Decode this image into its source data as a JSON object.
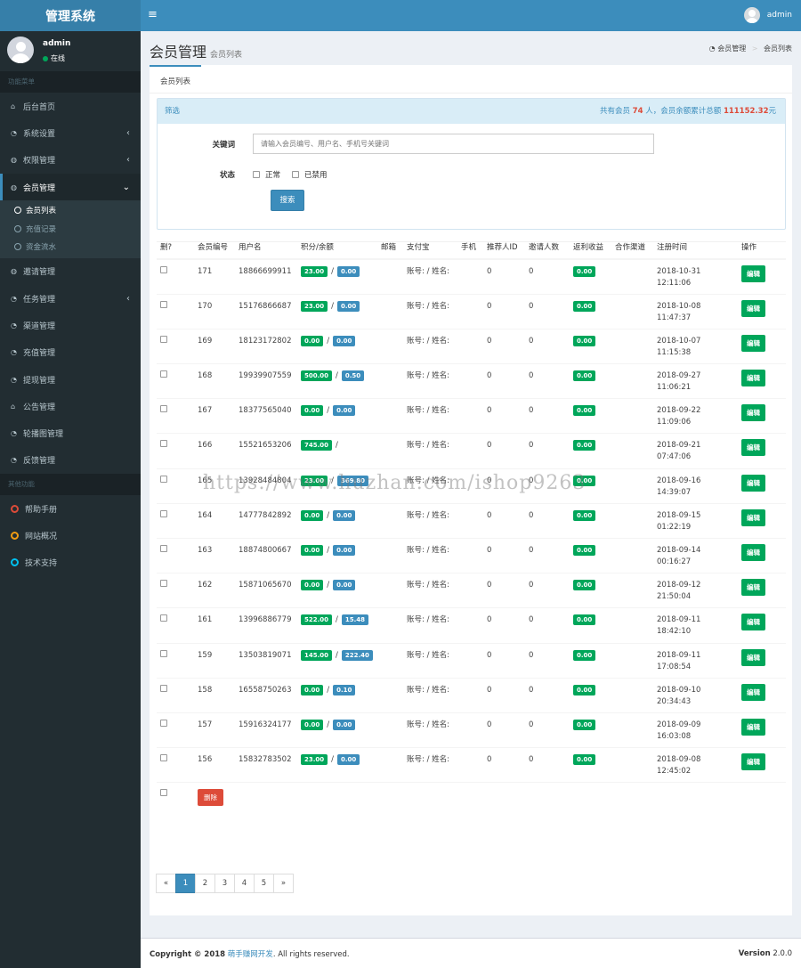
{
  "header": {
    "logo": "管理系统",
    "menu_icon": "≡",
    "username": "admin"
  },
  "sidebar": {
    "username": "admin",
    "status": "在线",
    "section1": "功能菜单",
    "items": [
      {
        "label": "后台首页",
        "icon": "home-icon",
        "glyph": "⌂",
        "chevron": ""
      },
      {
        "label": "系统设置",
        "icon": "dashboard-icon",
        "glyph": "◔",
        "chevron": "‹"
      },
      {
        "label": "权限管理",
        "icon": "users-icon",
        "glyph": "◍",
        "chevron": "‹"
      },
      {
        "label": "会员管理",
        "icon": "user-icon",
        "glyph": "◍",
        "chevron": "⌄"
      }
    ],
    "subitems": [
      "会员列表",
      "充值记录",
      "资金流水"
    ],
    "items2": [
      {
        "label": "邀请管理",
        "icon": "users-icon",
        "glyph": "◍",
        "chevron": ""
      },
      {
        "label": "任务管理",
        "icon": "tasks-icon",
        "glyph": "◔",
        "chevron": "‹"
      },
      {
        "label": "渠道管理",
        "icon": "dashboard-icon",
        "glyph": "◔",
        "chevron": ""
      },
      {
        "label": "充值管理",
        "icon": "dashboard-icon",
        "glyph": "◔",
        "chevron": ""
      },
      {
        "label": "提现管理",
        "icon": "dashboard-icon",
        "glyph": "◔",
        "chevron": ""
      },
      {
        "label": "公告管理",
        "icon": "home-icon",
        "glyph": "⌂",
        "chevron": ""
      },
      {
        "label": "轮播图管理",
        "icon": "dashboard-icon",
        "glyph": "◔",
        "chevron": ""
      },
      {
        "label": "反馈管理",
        "icon": "dashboard-icon",
        "glyph": "◔",
        "chevron": ""
      }
    ],
    "section2": "其他功能",
    "others": [
      {
        "label": "帮助手册",
        "color": "#dd4b39"
      },
      {
        "label": "网站概况",
        "color": "#f39c12"
      },
      {
        "label": "技术支持",
        "color": "#00c0ef"
      }
    ]
  },
  "page": {
    "title": "会员管理",
    "subtitle": "会员列表",
    "breadcrumb": [
      "会员管理",
      "会员列表"
    ],
    "tab": "会员列表"
  },
  "filter": {
    "title": "筛选",
    "stats_prefix": "共有会员",
    "count": "74",
    "stats_mid": "人，会员余额累计总额",
    "total": "111152.32",
    "stats_suffix": "元",
    "keyword_label": "关键词",
    "keyword_placeholder": "请输入会员编号、用户名、手机号关键词",
    "status_label": "状态",
    "status_options": [
      "正常",
      "已禁用"
    ],
    "search_button": "搜索"
  },
  "table": {
    "headers": [
      "删?",
      "会员编号",
      "用户名",
      "积分/余额",
      "邮箱",
      "支付宝",
      "手机",
      "推荐人ID",
      "邀请人数",
      "返利收益",
      "合作渠道",
      "注册时间",
      "操作"
    ],
    "alipay_text": "账号: / 姓名:",
    "edit_label": "编辑",
    "rows": [
      {
        "id": "171",
        "user": "18866699911",
        "points": "23.00",
        "balance": "0.00",
        "ref": "0",
        "inv": "0",
        "rebate": "0.00",
        "date": "2018-10-31",
        "time": "12:11:06"
      },
      {
        "id": "170",
        "user": "15176866687",
        "points": "23.00",
        "balance": "0.00",
        "ref": "0",
        "inv": "0",
        "rebate": "0.00",
        "date": "2018-10-08",
        "time": "11:47:37"
      },
      {
        "id": "169",
        "user": "18123172802",
        "points": "0.00",
        "balance": "0.00",
        "ref": "0",
        "inv": "0",
        "rebate": "0.00",
        "date": "2018-10-07",
        "time": "11:15:38"
      },
      {
        "id": "168",
        "user": "19939907559",
        "points": "500.00",
        "balance": "0.50",
        "ref": "0",
        "inv": "0",
        "rebate": "0.00",
        "date": "2018-09-27",
        "time": "11:06:21"
      },
      {
        "id": "167",
        "user": "18377565040",
        "points": "0.00",
        "balance": "0.00",
        "ref": "0",
        "inv": "0",
        "rebate": "0.00",
        "date": "2018-09-22",
        "time": "11:09:06"
      },
      {
        "id": "166",
        "user": "15521653206",
        "points": "745.00",
        "balance": "",
        "ref": "0",
        "inv": "0",
        "rebate": "0.00",
        "date": "2018-09-21",
        "time": "07:47:06"
      },
      {
        "id": "165",
        "user": "13928484804",
        "points": "23.00",
        "balance": "369.80",
        "ref": "0",
        "inv": "0",
        "rebate": "0.00",
        "date": "2018-09-16",
        "time": "14:39:07"
      },
      {
        "id": "164",
        "user": "14777842892",
        "points": "0.00",
        "balance": "0.00",
        "ref": "0",
        "inv": "0",
        "rebate": "0.00",
        "date": "2018-09-15",
        "time": "01:22:19"
      },
      {
        "id": "163",
        "user": "18874800667",
        "points": "0.00",
        "balance": "0.00",
        "ref": "0",
        "inv": "0",
        "rebate": "0.00",
        "date": "2018-09-14",
        "time": "00:16:27"
      },
      {
        "id": "162",
        "user": "15871065670",
        "points": "0.00",
        "balance": "0.00",
        "ref": "0",
        "inv": "0",
        "rebate": "0.00",
        "date": "2018-09-12",
        "time": "21:50:04"
      },
      {
        "id": "161",
        "user": "13996886779",
        "points": "522.00",
        "balance": "15.48",
        "ref": "0",
        "inv": "0",
        "rebate": "0.00",
        "date": "2018-09-11",
        "time": "18:42:10"
      },
      {
        "id": "159",
        "user": "13503819071",
        "points": "145.00",
        "balance": "222.40",
        "ref": "0",
        "inv": "0",
        "rebate": "0.00",
        "date": "2018-09-11",
        "time": "17:08:54"
      },
      {
        "id": "158",
        "user": "16558750263",
        "points": "0.00",
        "balance": "0.10",
        "ref": "0",
        "inv": "0",
        "rebate": "0.00",
        "date": "2018-09-10",
        "time": "20:34:43"
      },
      {
        "id": "157",
        "user": "15916324177",
        "points": "0.00",
        "balance": "0.00",
        "ref": "0",
        "inv": "0",
        "rebate": "0.00",
        "date": "2018-09-09",
        "time": "16:03:08"
      },
      {
        "id": "156",
        "user": "15832783502",
        "points": "23.00",
        "balance": "0.00",
        "ref": "0",
        "inv": "0",
        "rebate": "0.00",
        "date": "2018-09-08",
        "time": "12:45:02"
      }
    ],
    "delete_button": "删除"
  },
  "pagination": [
    "«",
    "1",
    "2",
    "3",
    "4",
    "5",
    "»"
  ],
  "watermark": "https://www.huzhan.com/ishop9263",
  "footer": {
    "copyright": "Copyright © 2018",
    "company": "萌手赚网开发",
    "rights": ". All rights reserved.",
    "version_label": "Version",
    "version": "2.0.0"
  }
}
